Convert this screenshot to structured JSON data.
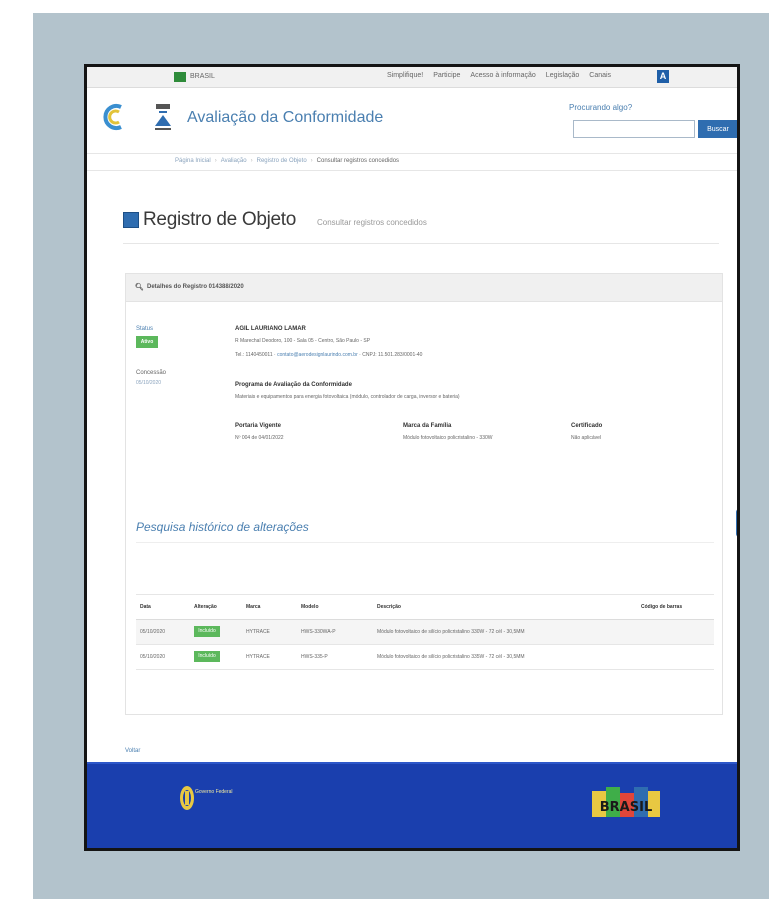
{
  "govbar": {
    "label": "BRASIL",
    "links": [
      "Simplifique!",
      "Participe",
      "Acesso à informação",
      "Legislação",
      "Canais"
    ],
    "a11y_label": "A"
  },
  "header": {
    "site_title": "Avaliação da Conformidade",
    "search_label": "Procurando algo?",
    "search_placeholder": "",
    "search_button": "Buscar"
  },
  "breadcrumb": [
    "Página Inicial",
    "Avaliação",
    "Registro de Objeto",
    "Consultar registros concedidos"
  ],
  "page": {
    "title": "Registro de Objeto",
    "subtitle": "Consultar registros concedidos"
  },
  "details": {
    "header": "Detalhes do Registro 014388/2020",
    "status_label": "Status",
    "status_value": "Ativo",
    "concession_label": "Concessão",
    "concession_value": "05/10/2020",
    "company_name": "AGIL LAURIANO LAMAR",
    "address": "R Marechal Deodoro, 100 - Sala 05 - Centro, São Paulo - SP",
    "contact_phone": "Tel.: 1140450011",
    "contact_email": "contato@aerodesignlaurindo.com.br",
    "contact_cnpj": "CNPJ: 11.501.283/0001-40",
    "program_label": "Programa de Avaliação da Conformidade",
    "program_desc": "Materiais e equipamentos para energia fotovoltaica (módulo, controlador de carga, inversor e bateria)",
    "fields": [
      {
        "label": "Portaria Vigente",
        "value": "Nº 004 de 04/01/2022"
      },
      {
        "label": "Marca da Família",
        "value": "Módulo fotovoltaico policristalino - 330W"
      },
      {
        "label": "Certificado",
        "value": "Não aplicável"
      }
    ]
  },
  "history": {
    "title": "Pesquisa histórico de alterações"
  },
  "table": {
    "headers": [
      "Data",
      "Alteração",
      "Marca",
      "Modelo",
      "Descrição",
      "Código de barras"
    ],
    "rows": [
      {
        "date": "05/10/2020",
        "change": "Incluído",
        "brand": "HYTRACE",
        "model": "HWS-330WA-P",
        "description": "Módulo fotovoltaico de silício policristalino 330W - 72 cél - 30,5MM",
        "barcode": ""
      },
      {
        "date": "05/10/2020",
        "change": "Incluído",
        "brand": "HYTRACE",
        "model": "HWS-335-P",
        "description": "Módulo fotovoltaico de silício policristalino 335W - 72 cél - 30,5MM",
        "barcode": ""
      }
    ]
  },
  "footer": {
    "link": "Voltar",
    "emblem_text": "Governo Federal",
    "brand": "BRASIL"
  },
  "colors": {
    "accent_blue": "#2f6db0",
    "status_green": "#5cb85c",
    "footer_blue": "#1a3fae",
    "title_blue": "#4a7fb0"
  }
}
